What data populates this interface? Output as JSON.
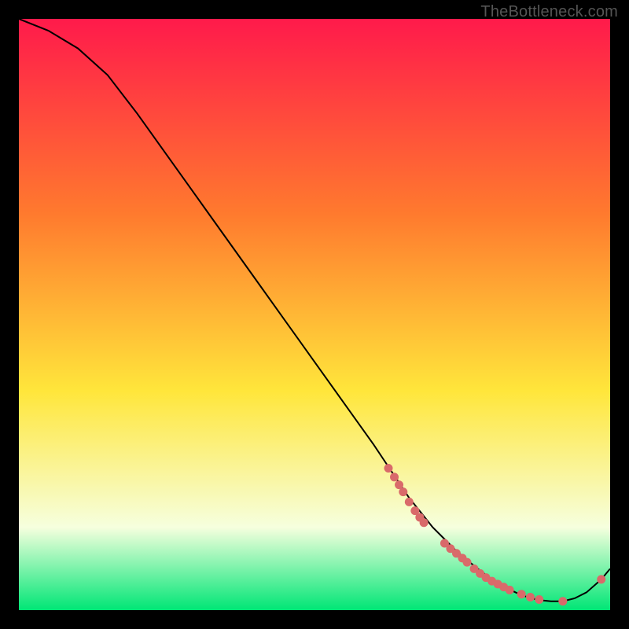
{
  "watermark": "TheBottleneck.com",
  "colors": {
    "grad_top": "#ff1a4b",
    "grad_orange": "#ff7a2e",
    "grad_yellow": "#ffe63b",
    "grad_pale": "#f6ffde",
    "grad_green": "#00e676",
    "curve": "#000000",
    "marker": "#d96a6a",
    "frame": "#000000"
  },
  "chart_data": {
    "type": "line",
    "title": "",
    "xlabel": "",
    "ylabel": "",
    "xlim": [
      0,
      100
    ],
    "ylim": [
      0,
      100
    ],
    "series": [
      {
        "name": "bottleneck-curve",
        "x": [
          0,
          5,
          10,
          15,
          20,
          25,
          30,
          35,
          40,
          45,
          50,
          55,
          60,
          62,
          64,
          66,
          68,
          70,
          72,
          74,
          76,
          78,
          80,
          82,
          84,
          86,
          88,
          90,
          92,
          94,
          96,
          98.5,
          100
        ],
        "y": [
          100,
          98,
          95,
          90.5,
          84,
          77,
          70,
          63,
          56,
          49,
          42,
          35,
          28,
          25,
          22,
          19,
          16.5,
          14,
          12,
          10,
          8.3,
          6.7,
          5.2,
          4,
          3,
          2.2,
          1.7,
          1.5,
          1.5,
          2,
          3,
          5.2,
          7
        ]
      }
    ],
    "markers": {
      "name": "highlight-points",
      "x": [
        62.5,
        63.5,
        64.3,
        65,
        66,
        67,
        67.8,
        68.5,
        72,
        73,
        74,
        75,
        75.8,
        77,
        78,
        79,
        80,
        81,
        82,
        83,
        85,
        86.5,
        88,
        92,
        98.5
      ],
      "y": [
        24,
        22.5,
        21.2,
        20,
        18.3,
        16.8,
        15.7,
        14.8,
        11.3,
        10.4,
        9.6,
        8.8,
        8.1,
        7,
        6.2,
        5.5,
        4.9,
        4.4,
        3.9,
        3.4,
        2.7,
        2.2,
        1.8,
        1.5,
        5.2
      ]
    }
  }
}
